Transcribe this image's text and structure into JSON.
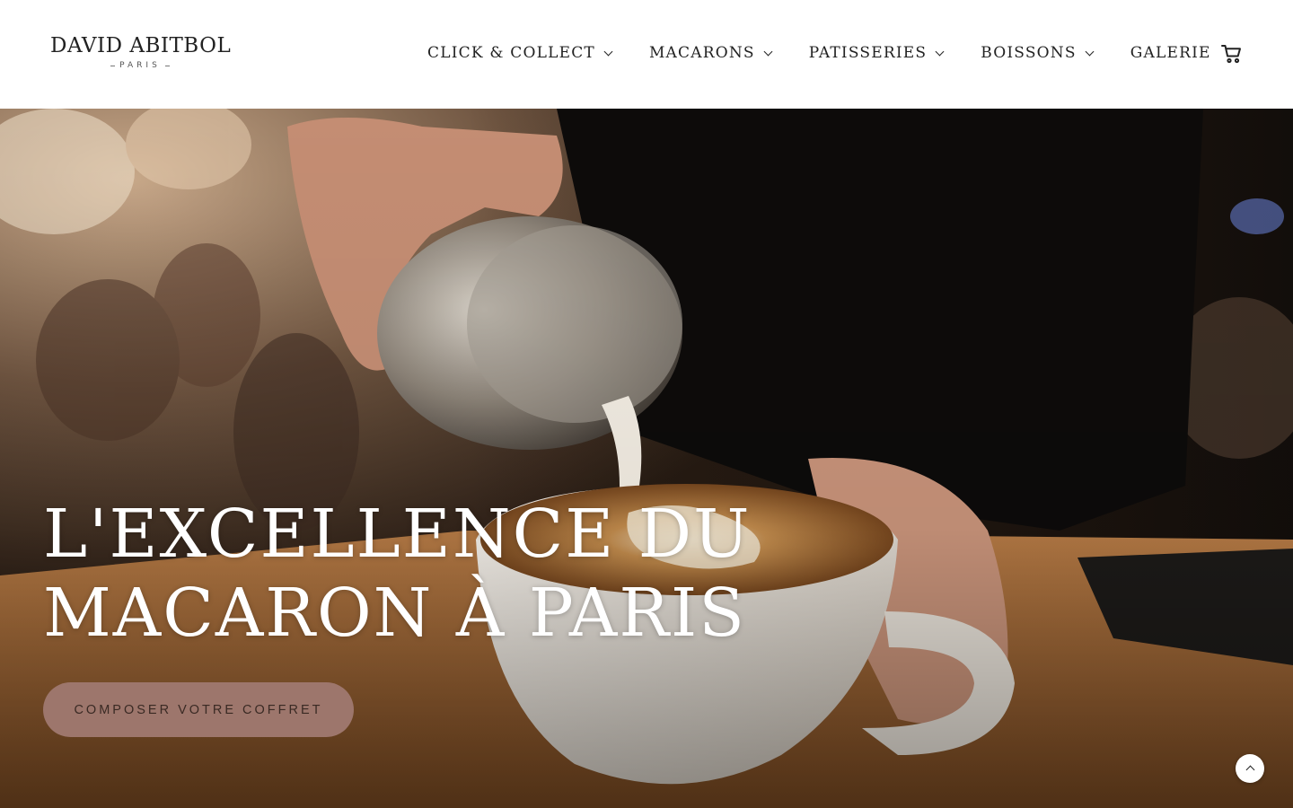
{
  "header": {
    "logo": {
      "main": "DAVID ABITBOL",
      "sub": "PARIS"
    },
    "nav": [
      {
        "label": "CLICK & COLLECT",
        "has_dropdown": true
      },
      {
        "label": "MACARONS",
        "has_dropdown": true
      },
      {
        "label": "PATISSERIES",
        "has_dropdown": true
      },
      {
        "label": "BOISSONS",
        "has_dropdown": true
      },
      {
        "label": "GALERIE",
        "has_dropdown": false
      }
    ],
    "cart_icon": "shopping-cart-icon"
  },
  "hero": {
    "title_line1": "L'EXCELLENCE DU",
    "title_line2": "MACARON À PARIS",
    "cta_label": "COMPOSER VOTRE COFFRET",
    "image_subject": "barista pouring milk latte art into a white cup",
    "colors": {
      "cta_bg": "#9d766c",
      "title": "#ffffff"
    }
  },
  "scroll_top_icon": "chevron-up-icon"
}
